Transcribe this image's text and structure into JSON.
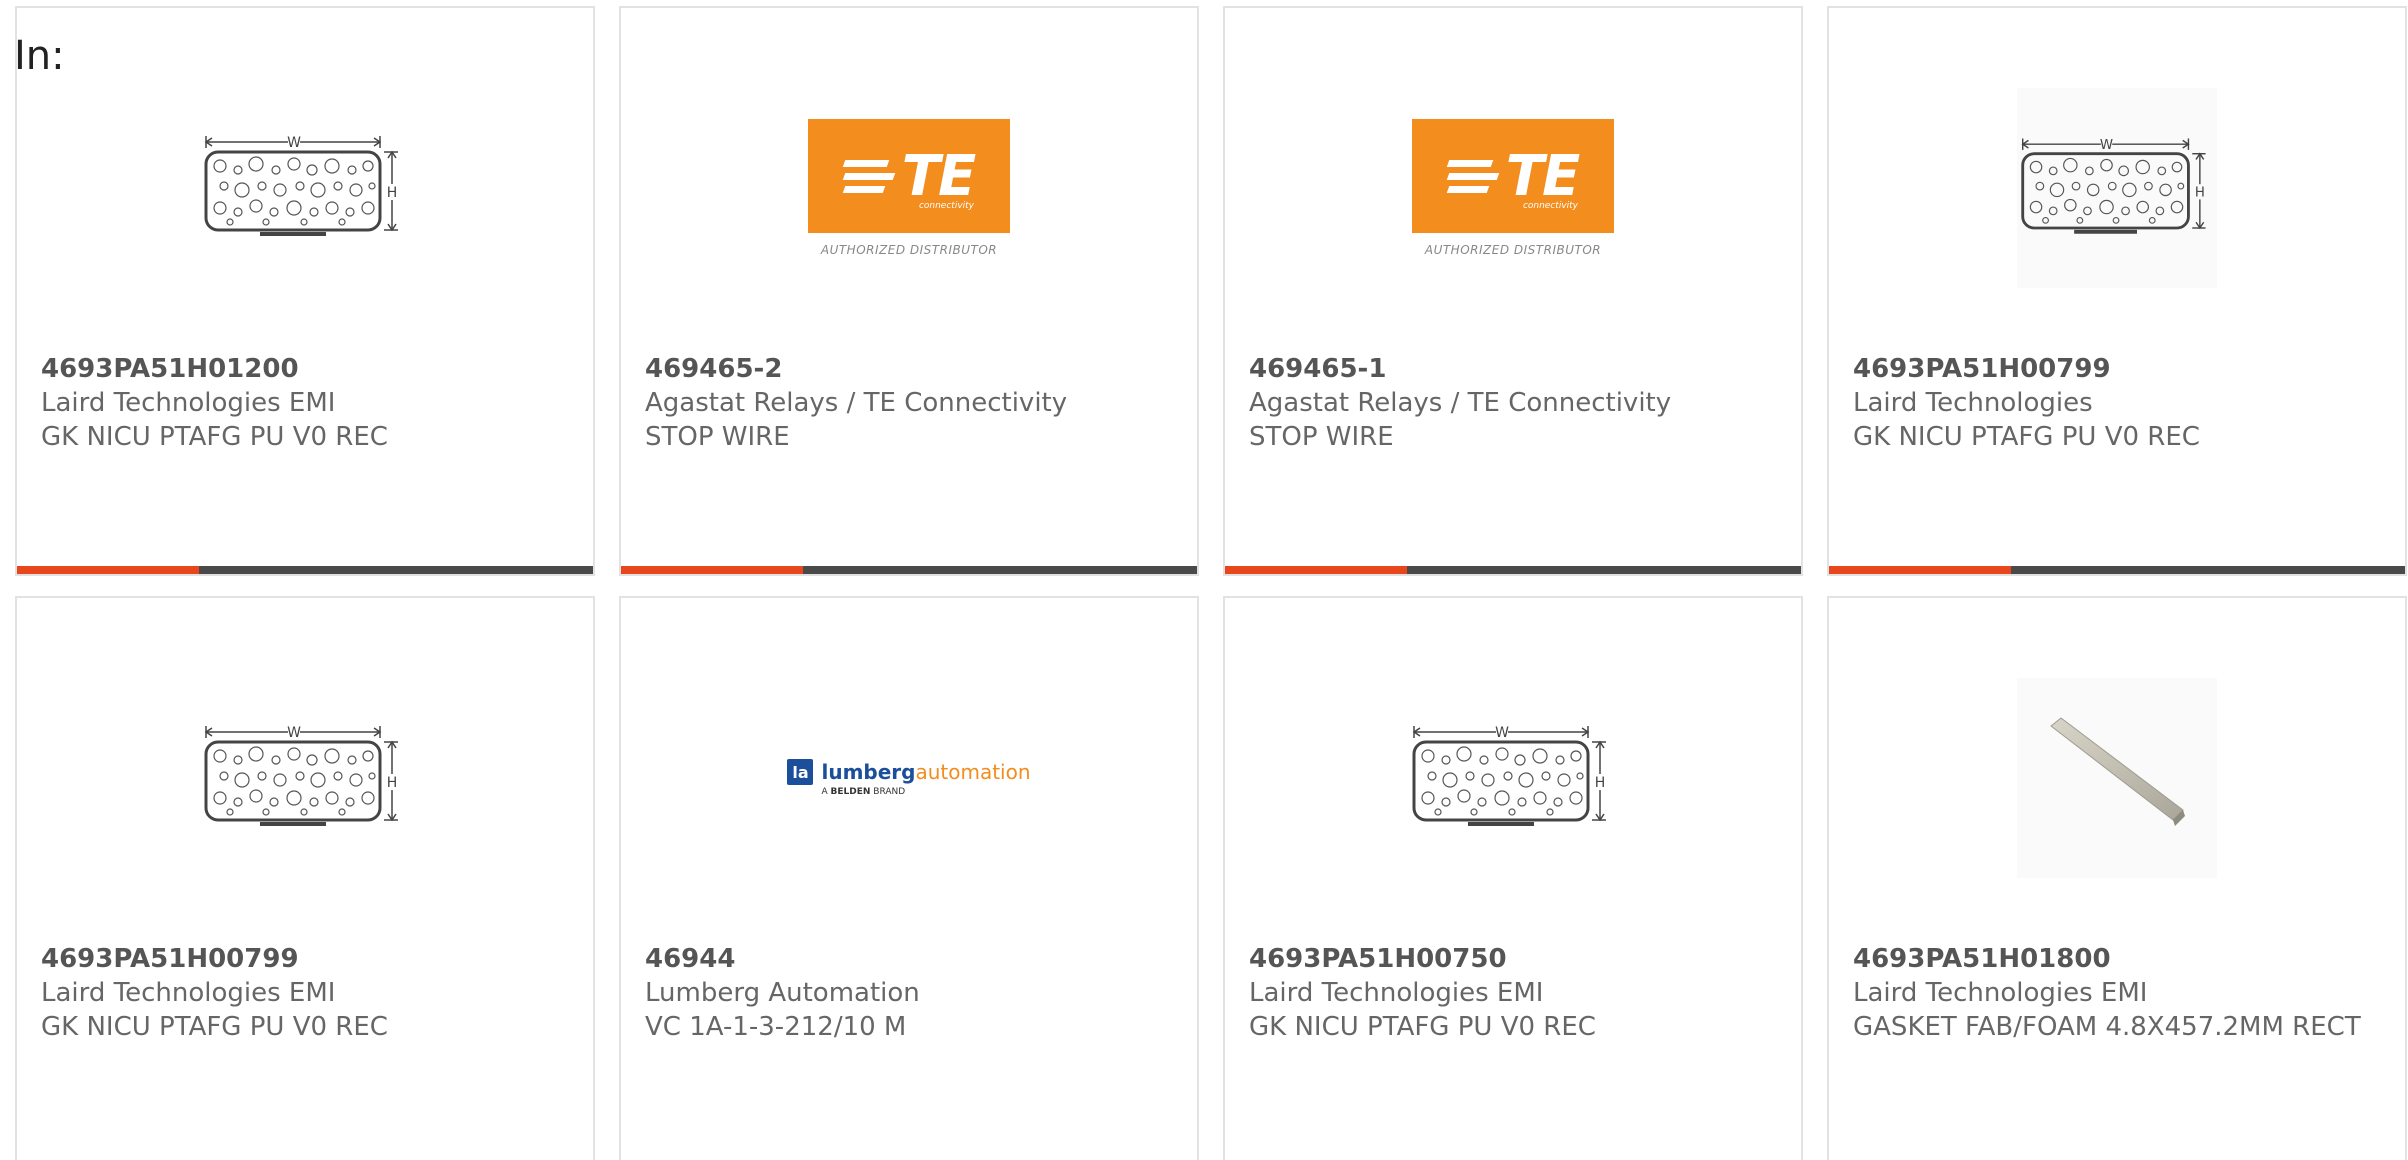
{
  "header": {
    "label": "In:"
  },
  "colors": {
    "accent": "#e8461c",
    "bar": "#4a4a4a",
    "te_orange": "#f28d1e",
    "lumberg_blue": "#1b4e9b"
  },
  "cards": [
    {
      "part_number": "4693PA51H01200",
      "manufacturer": "Laird Technologies EMI",
      "description": "GK NICU PTAFG PU V0 REC",
      "image": "gasket-dimension-drawing"
    },
    {
      "part_number": "469465-2",
      "manufacturer": "Agastat Relays / TE Connectivity",
      "description": "STOP WIRE",
      "image": "te-connectivity-logo"
    },
    {
      "part_number": "469465-1",
      "manufacturer": "Agastat Relays / TE Connectivity",
      "description": "STOP WIRE",
      "image": "te-connectivity-logo"
    },
    {
      "part_number": "4693PA51H00799",
      "manufacturer": "Laird Technologies",
      "description": "GK NICU PTAFG PU V0 REC",
      "image": "gasket-dimension-drawing"
    },
    {
      "part_number": "4693PA51H00799",
      "manufacturer": "Laird Technologies EMI",
      "description": "GK NICU PTAFG PU V0 REC",
      "image": "gasket-dimension-drawing"
    },
    {
      "part_number": "46944",
      "manufacturer": "Lumberg Automation",
      "description": "VC 1A-1-3-212/10 M",
      "image": "lumberg-automation-logo"
    },
    {
      "part_number": "4693PA51H00750",
      "manufacturer": "Laird Technologies EMI",
      "description": "GK NICU PTAFG PU V0 REC",
      "image": "gasket-dimension-drawing"
    },
    {
      "part_number": "4693PA51H01800",
      "manufacturer": "Laird Technologies EMI",
      "description": "GASKET FAB/FOAM 4.8X457.2MM RECT",
      "image": "gasket-strip-photo"
    }
  ],
  "logos": {
    "te_word": "TE",
    "te_sub": "connectivity",
    "te_authorized": "AUTHORIZED DISTRIBUTOR",
    "lumberg_badge": "la",
    "lumberg_name": "lumberg",
    "lumberg_auto": "automation",
    "lumberg_sub_prefix": "A",
    "lumberg_sub_brand": "BELDEN",
    "lumberg_sub_suffix": "BRAND"
  },
  "drawing": {
    "width_label": "W",
    "height_label": "H"
  }
}
